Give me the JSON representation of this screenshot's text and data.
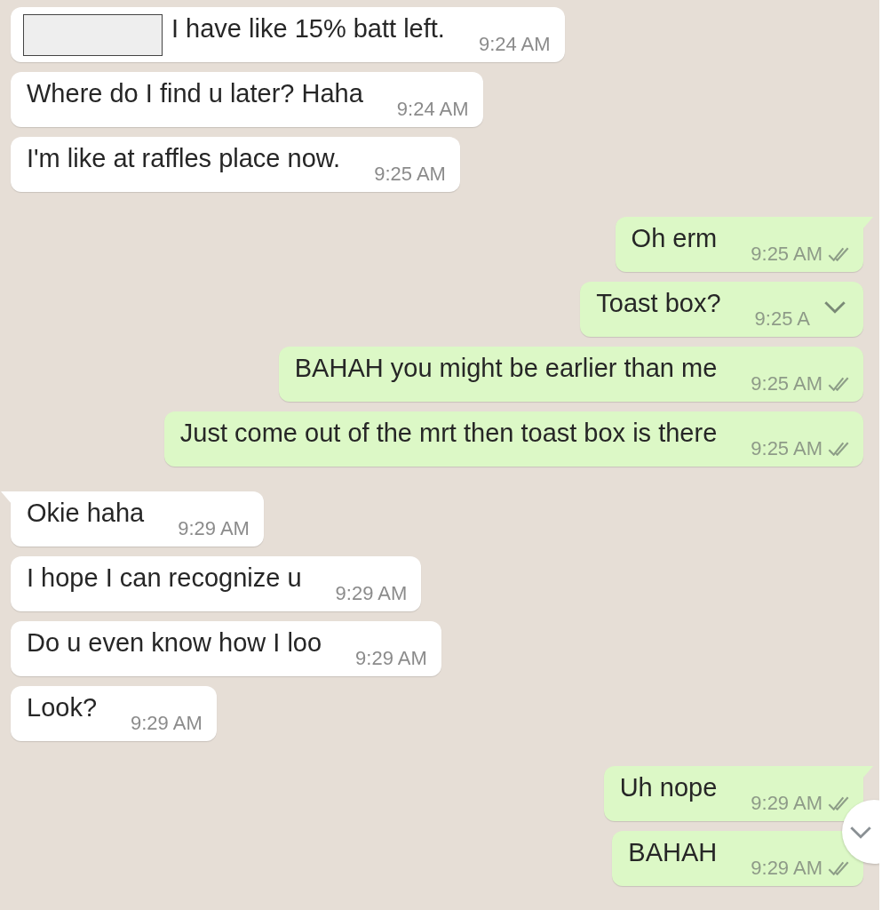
{
  "messages": [
    {
      "kind": "incoming",
      "tail": false,
      "redacted": true,
      "text": "I have like 15% batt left.",
      "time": "9:24 AM",
      "ticks": false,
      "menu_chevron": false
    },
    {
      "kind": "incoming",
      "tail": false,
      "redacted": false,
      "text": "Where do I find u later? Haha",
      "time": "9:24 AM",
      "ticks": false,
      "menu_chevron": false
    },
    {
      "kind": "incoming",
      "tail": false,
      "redacted": false,
      "text": "I'm like at raffles place now.",
      "time": "9:25 AM",
      "ticks": false,
      "menu_chevron": false
    },
    {
      "kind": "outgoing",
      "tail": true,
      "redacted": false,
      "text": "Oh erm",
      "time": "9:25 AM",
      "ticks": true,
      "menu_chevron": false
    },
    {
      "kind": "outgoing",
      "tail": false,
      "redacted": false,
      "text": "Toast box?",
      "time": "9:25 A",
      "ticks": false,
      "menu_chevron": true
    },
    {
      "kind": "outgoing",
      "tail": false,
      "redacted": false,
      "text": "BAHAH you might be earlier than me",
      "time": "9:25 AM",
      "ticks": true,
      "menu_chevron": false
    },
    {
      "kind": "outgoing",
      "tail": false,
      "redacted": false,
      "text": "Just come out of the mrt then toast box is there",
      "time": "9:25 AM",
      "ticks": true,
      "menu_chevron": false
    },
    {
      "kind": "incoming",
      "tail": true,
      "redacted": false,
      "text": "Okie haha",
      "time": "9:29 AM",
      "ticks": false,
      "menu_chevron": false
    },
    {
      "kind": "incoming",
      "tail": false,
      "redacted": false,
      "text": "I hope I can recognize u",
      "time": "9:29 AM",
      "ticks": false,
      "menu_chevron": false
    },
    {
      "kind": "incoming",
      "tail": false,
      "redacted": false,
      "text": "Do u even know how I loo",
      "time": "9:29 AM",
      "ticks": false,
      "menu_chevron": false
    },
    {
      "kind": "incoming",
      "tail": false,
      "redacted": false,
      "text": "Look?",
      "time": "9:29 AM",
      "ticks": false,
      "menu_chevron": false
    },
    {
      "kind": "outgoing",
      "tail": true,
      "redacted": false,
      "text": "Uh nope",
      "time": "9:29 AM",
      "ticks": true,
      "menu_chevron": false
    },
    {
      "kind": "outgoing",
      "tail": false,
      "redacted": false,
      "text": "BAHAH",
      "time": "9:29 AM",
      "ticks": true,
      "menu_chevron": false
    }
  ]
}
